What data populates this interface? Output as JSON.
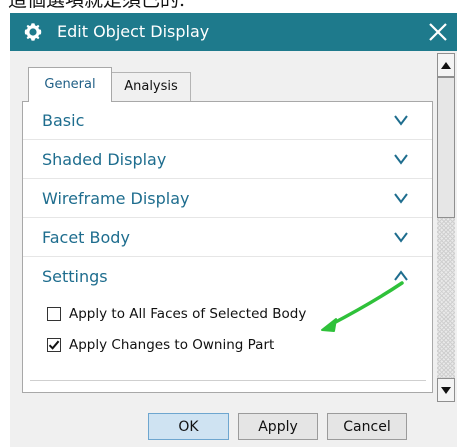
{
  "caption": {
    "text": "這個選項就是須已的."
  },
  "dialog": {
    "title": "Edit Object Display",
    "tabs": [
      {
        "label": "General",
        "active": true
      },
      {
        "label": "Analysis",
        "active": false
      }
    ],
    "sections": [
      {
        "label": "Basic",
        "expanded": false
      },
      {
        "label": "Shaded Display",
        "expanded": false
      },
      {
        "label": "Wireframe Display",
        "expanded": false
      },
      {
        "label": "Facet Body",
        "expanded": false
      },
      {
        "label": "Settings",
        "expanded": true
      }
    ],
    "settings": {
      "options": [
        {
          "label": "Apply to All Faces of Selected Body",
          "checked": false
        },
        {
          "label": "Apply Changes to Owning Part",
          "checked": true
        }
      ]
    },
    "buttons": {
      "ok": "OK",
      "apply": "Apply",
      "cancel": "Cancel"
    }
  },
  "icons": {
    "title": "gear-icon",
    "close": "close-icon",
    "collapsed": "chevron-down-icon",
    "expanded": "chevron-up-icon",
    "scroll_up": "arrow-up-icon",
    "scroll_down": "arrow-down-icon",
    "annotation": "arrow-annotation-icon"
  },
  "colors": {
    "title_bar": "#1e7a8c",
    "section_label": "#1e6d8e",
    "annotation_arrow": "#2fc13a",
    "ok_button": "#cfe3f2"
  }
}
